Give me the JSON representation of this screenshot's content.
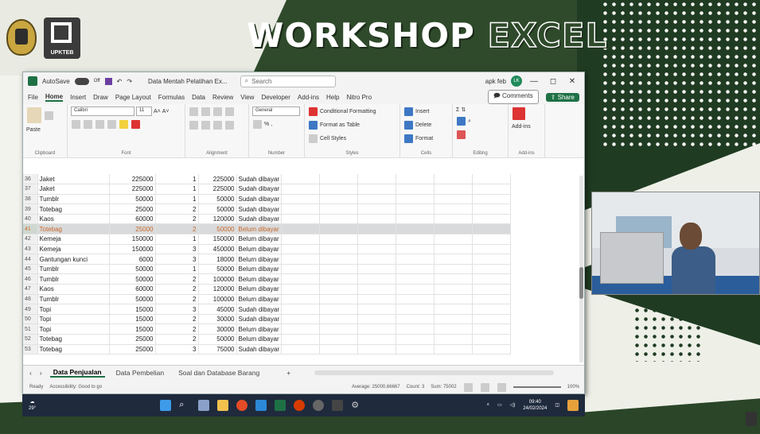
{
  "slide": {
    "title_part1": "WORKSHOP",
    "title_part2": "EXCEL",
    "logo_text": "UPKTEB"
  },
  "window": {
    "autosave_label": "AutoSave",
    "autosave_state": "Off",
    "doc_title": "Data Mentah Pelatihan Ex...",
    "search_placeholder": "Search",
    "user_name": "apk feb",
    "user_initials": "LK",
    "minimize": "—",
    "maximize": "◻",
    "close": "✕"
  },
  "menu": {
    "items": [
      "File",
      "Home",
      "Insert",
      "Draw",
      "Page Layout",
      "Formulas",
      "Data",
      "Review",
      "View",
      "Developer",
      "Add-ins",
      "Help",
      "Nitro Pro"
    ],
    "active": "Home",
    "comments_label": "Comments",
    "share_label": "Share"
  },
  "ribbon": {
    "paste_label": "Paste",
    "font_name": "Calibri",
    "font_size": "11",
    "number_format": "General",
    "conditional_formatting": "Conditional Formatting",
    "format_as_table": "Format as Table",
    "cell_styles": "Cell Styles",
    "insert": "Insert",
    "delete": "Delete",
    "format": "Format",
    "add_ins": "Add-ins",
    "group_clipboard": "Clipboard",
    "group_font": "Font",
    "group_alignment": "Alignment",
    "group_number": "Number",
    "group_styles": "Styles",
    "group_cells": "Cells",
    "group_editing": "Editing",
    "group_addins": "Add-ins"
  },
  "rows": [
    {
      "n": "36",
      "item": "Jaket",
      "price": "225000",
      "qty": "1",
      "total": "225000",
      "status": "Sudah dibayar"
    },
    {
      "n": "37",
      "item": "Jaket",
      "price": "225000",
      "qty": "1",
      "total": "225000",
      "status": "Sudah dibayar"
    },
    {
      "n": "38",
      "item": "Tumblr",
      "price": "50000",
      "qty": "1",
      "total": "50000",
      "status": "Sudah dibayar"
    },
    {
      "n": "39",
      "item": "Totebag",
      "price": "25000",
      "qty": "2",
      "total": "50000",
      "status": "Sudah dibayar"
    },
    {
      "n": "40",
      "item": "Kaos",
      "price": "60000",
      "qty": "2",
      "total": "120000",
      "status": "Sudah dibayar"
    },
    {
      "n": "41",
      "item": "Totebag",
      "price": "25000",
      "qty": "2",
      "total": "50000",
      "status": "Belum dibayar"
    },
    {
      "n": "42",
      "item": "Kemeja",
      "price": "150000",
      "qty": "1",
      "total": "150000",
      "status": "Belum dibayar"
    },
    {
      "n": "43",
      "item": "Kemeja",
      "price": "150000",
      "qty": "3",
      "total": "450000",
      "status": "Belum dibayar"
    },
    {
      "n": "44",
      "item": "Gantungan kunci",
      "price": "6000",
      "qty": "3",
      "total": "18000",
      "status": "Belum dibayar"
    },
    {
      "n": "45",
      "item": "Tumblr",
      "price": "50000",
      "qty": "1",
      "total": "50000",
      "status": "Belum dibayar"
    },
    {
      "n": "46",
      "item": "Tumblr",
      "price": "50000",
      "qty": "2",
      "total": "100000",
      "status": "Belum dibayar"
    },
    {
      "n": "47",
      "item": "Kaos",
      "price": "60000",
      "qty": "2",
      "total": "120000",
      "status": "Belum dibayar"
    },
    {
      "n": "48",
      "item": "Tumblr",
      "price": "50000",
      "qty": "2",
      "total": "100000",
      "status": "Belum dibayar"
    },
    {
      "n": "49",
      "item": "Topi",
      "price": "15000",
      "qty": "3",
      "total": "45000",
      "status": "Sudah dibayar"
    },
    {
      "n": "50",
      "item": "Topi",
      "price": "15000",
      "qty": "2",
      "total": "30000",
      "status": "Sudah dibayar"
    },
    {
      "n": "51",
      "item": "Topi",
      "price": "15000",
      "qty": "2",
      "total": "30000",
      "status": "Belum dibayar"
    },
    {
      "n": "52",
      "item": "Totebag",
      "price": "25000",
      "qty": "2",
      "total": "50000",
      "status": "Belum dibayar"
    },
    {
      "n": "53",
      "item": "Totebag",
      "price": "25000",
      "qty": "3",
      "total": "75000",
      "status": "Sudah dibayar"
    }
  ],
  "selected_row": "41",
  "sheets": {
    "tabs": [
      "Data Penjualan",
      "Data Pembelian",
      "Soal dan Database Barang"
    ],
    "active": "Data Penjualan",
    "add": "+"
  },
  "status": {
    "ready": "Ready",
    "accessibility": "Accessibility: Good to go",
    "average": "Average: 25000,66667",
    "count": "Count: 3",
    "sum": "Sum: 75002",
    "zoom": "100%"
  },
  "taskbar": {
    "weather": "29°",
    "time": "09:40",
    "date": "24/02/2024"
  },
  "colors": {
    "excel_green": "#1e7145",
    "selection_text": "#c7682a",
    "slide_dark_green": "#2f4a2b"
  }
}
